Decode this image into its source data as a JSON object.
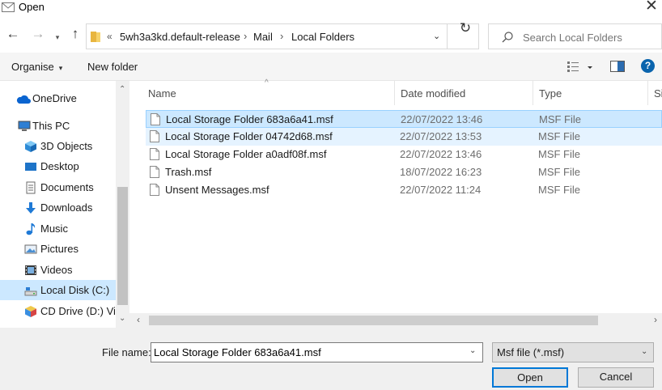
{
  "window": {
    "title": "Open",
    "close_glyph": "✕"
  },
  "nav": {
    "back": "←",
    "forward": "→",
    "recent": "▾",
    "up": "↑",
    "address": {
      "overflow": "«",
      "crumbs": [
        "5wh3a3kd.default-release",
        "Mail",
        "Local Folders"
      ],
      "separator": "›",
      "dropdown": "⌄"
    },
    "refresh": "↻",
    "search_placeholder": "Search Local Folders"
  },
  "toolbar": {
    "organise": "Organise",
    "organise_caret": "▾",
    "new_folder": "New folder",
    "help": "?"
  },
  "sidebar": {
    "items": [
      {
        "label": "OneDrive",
        "icon": "cloud-icon"
      },
      {
        "label": "This PC",
        "icon": "computer-icon"
      },
      {
        "label": "3D Objects",
        "icon": "cube-icon"
      },
      {
        "label": "Desktop",
        "icon": "desktop-icon"
      },
      {
        "label": "Documents",
        "icon": "document-icon"
      },
      {
        "label": "Downloads",
        "icon": "download-arrow-icon"
      },
      {
        "label": "Music",
        "icon": "music-note-icon"
      },
      {
        "label": "Pictures",
        "icon": "picture-icon"
      },
      {
        "label": "Videos",
        "icon": "film-icon"
      },
      {
        "label": "Local Disk (C:)",
        "icon": "disk-icon",
        "selected": true
      },
      {
        "label": "CD Drive (D:) Virt",
        "icon": "cd-drive-icon"
      }
    ]
  },
  "filelist": {
    "columns": [
      "Name",
      "Date modified",
      "Type",
      "Si"
    ],
    "sort_glyph": "^",
    "rows": [
      {
        "name": "Local Storage Folder 683a6a41.msf",
        "date": "22/07/2022 13:46",
        "type": "MSF File",
        "state": "selected"
      },
      {
        "name": "Local Storage Folder 04742d68.msf",
        "date": "22/07/2022 13:53",
        "type": "MSF File",
        "state": "hover"
      },
      {
        "name": "Local Storage Folder a0adf08f.msf",
        "date": "22/07/2022 13:46",
        "type": "MSF File",
        "state": ""
      },
      {
        "name": "Trash.msf",
        "date": "18/07/2022 16:23",
        "type": "MSF File",
        "state": ""
      },
      {
        "name": "Unsent Messages.msf",
        "date": "22/07/2022 11:24",
        "type": "MSF File",
        "state": ""
      }
    ]
  },
  "scroll": {
    "up": "⌃",
    "down": "⌄",
    "left": "‹",
    "right": "›"
  },
  "footer": {
    "filename_label": "File name:",
    "filename_value": "Local Storage Folder 683a6a41.msf",
    "filetype_value": "Msf file (*.msf)",
    "dropdown": "⌄",
    "open_label": "Open",
    "cancel_label": "Cancel"
  },
  "colors": {
    "selection": "#cce8ff",
    "hover": "#e5f3ff",
    "accent": "#0078d7",
    "help": "#0a64ad"
  }
}
